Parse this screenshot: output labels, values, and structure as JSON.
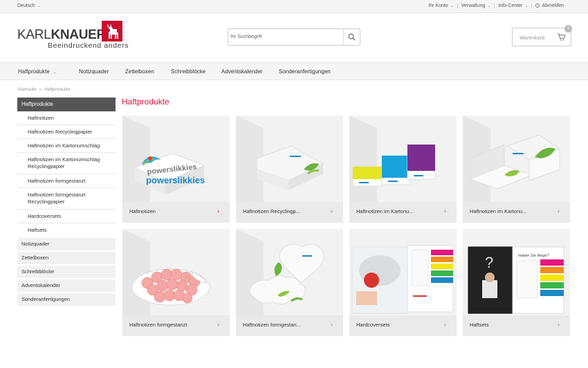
{
  "topbar": {
    "language": "Deutsch",
    "links": [
      "Ihr Konto",
      "Verwaltung",
      "Info-Center",
      "Abmelden"
    ]
  },
  "logo": {
    "brand_light": "KARL",
    "brand_bold": "KNAUER",
    "tagline": "Beeindruckend anders"
  },
  "search": {
    "placeholder": "Ihr Suchbegriff"
  },
  "cart": {
    "label": "Warenkorb",
    "count": "1"
  },
  "nav": {
    "items": [
      "Haftprodukte",
      "Notizquader",
      "Zettelboxen",
      "Schreibblöcke",
      "Adventskalender",
      "Sonderanfertigungen"
    ]
  },
  "breadcrumb": {
    "home": "Startseite",
    "separator": "»",
    "current": "Haftprodukte"
  },
  "sidebar": {
    "active": "Haftprodukte",
    "subitems": [
      "Haftnotizen",
      "Haftnotizen Recyclingpapier",
      "Haftnotizen im Kartonumschlag",
      "Haftnotizen im Kartonumschlag Recyclingpapier",
      "Haftnotizen formgestanzt",
      "Haftnotizen formgestanzt Recyclingpapier",
      "Hardcoversets",
      "Haftsets"
    ],
    "topitems": [
      "Notizquader",
      "Zettelboxen",
      "Schreibblöcke",
      "Adventskalender",
      "Sonderanfertigungen"
    ]
  },
  "page_title": "Haftprodukte",
  "products": [
    {
      "label": "Haftnotizen",
      "arrow": "›"
    },
    {
      "label": "Haftnotizen Recyclingp...",
      "arrow": "›"
    },
    {
      "label": "Haftnotizen im Kartonu...",
      "arrow": "›"
    },
    {
      "label": "Haftnotizen im Kartonu...",
      "arrow": "›"
    },
    {
      "label": "Haftnotizen formgestanzt",
      "arrow": "›"
    },
    {
      "label": "Haftnotizen formgestan...",
      "arrow": "›"
    },
    {
      "label": "Hardcoversets",
      "arrow": "›"
    },
    {
      "label": "Haftsets",
      "arrow": "›"
    }
  ],
  "product_images": {
    "powerslikkies_text": "powerslikkies",
    "signage_text": "Haben Sie Wege?"
  },
  "colors": {
    "accent": "#d2143a",
    "logo_red": "#c8102e",
    "sidebar_active": "#555555"
  }
}
